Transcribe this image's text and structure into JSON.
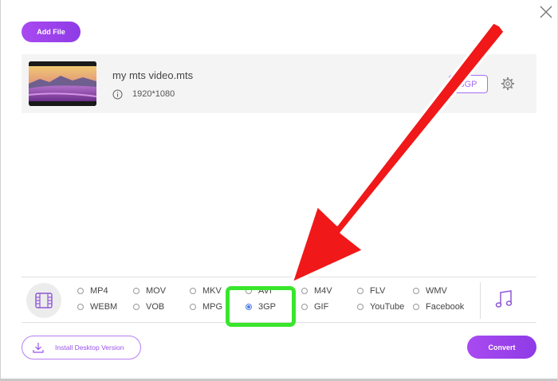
{
  "toolbar": {
    "add_file_label": "Add File"
  },
  "file": {
    "name": "my mts video.mts",
    "resolution": "1920*1080",
    "output_format": "3GP"
  },
  "formats": {
    "options": [
      {
        "label": "MP4",
        "selected": false
      },
      {
        "label": "MOV",
        "selected": false
      },
      {
        "label": "MKV",
        "selected": false
      },
      {
        "label": "AVI",
        "selected": false
      },
      {
        "label": "M4V",
        "selected": false
      },
      {
        "label": "FLV",
        "selected": false
      },
      {
        "label": "WMV",
        "selected": false
      },
      {
        "label": "WEBM",
        "selected": false
      },
      {
        "label": "VOB",
        "selected": false
      },
      {
        "label": "MPG",
        "selected": false
      },
      {
        "label": "3GP",
        "selected": true
      },
      {
        "label": "GIF",
        "selected": false
      },
      {
        "label": "YouTube",
        "selected": false
      },
      {
        "label": "Facebook",
        "selected": false
      }
    ]
  },
  "footer": {
    "install_label": "Install Desktop Version",
    "convert_label": "Convert"
  },
  "colors": {
    "accent": "#9b45ee",
    "highlight": "#39e62c",
    "arrow": "#f01818",
    "radio_selected": "#4a7ce8"
  },
  "icons": [
    "close-icon",
    "video-thumbnail",
    "info-icon",
    "settings-gear-icon",
    "film-icon",
    "music-note-icon",
    "download-icon",
    "radio-selected-icon"
  ]
}
